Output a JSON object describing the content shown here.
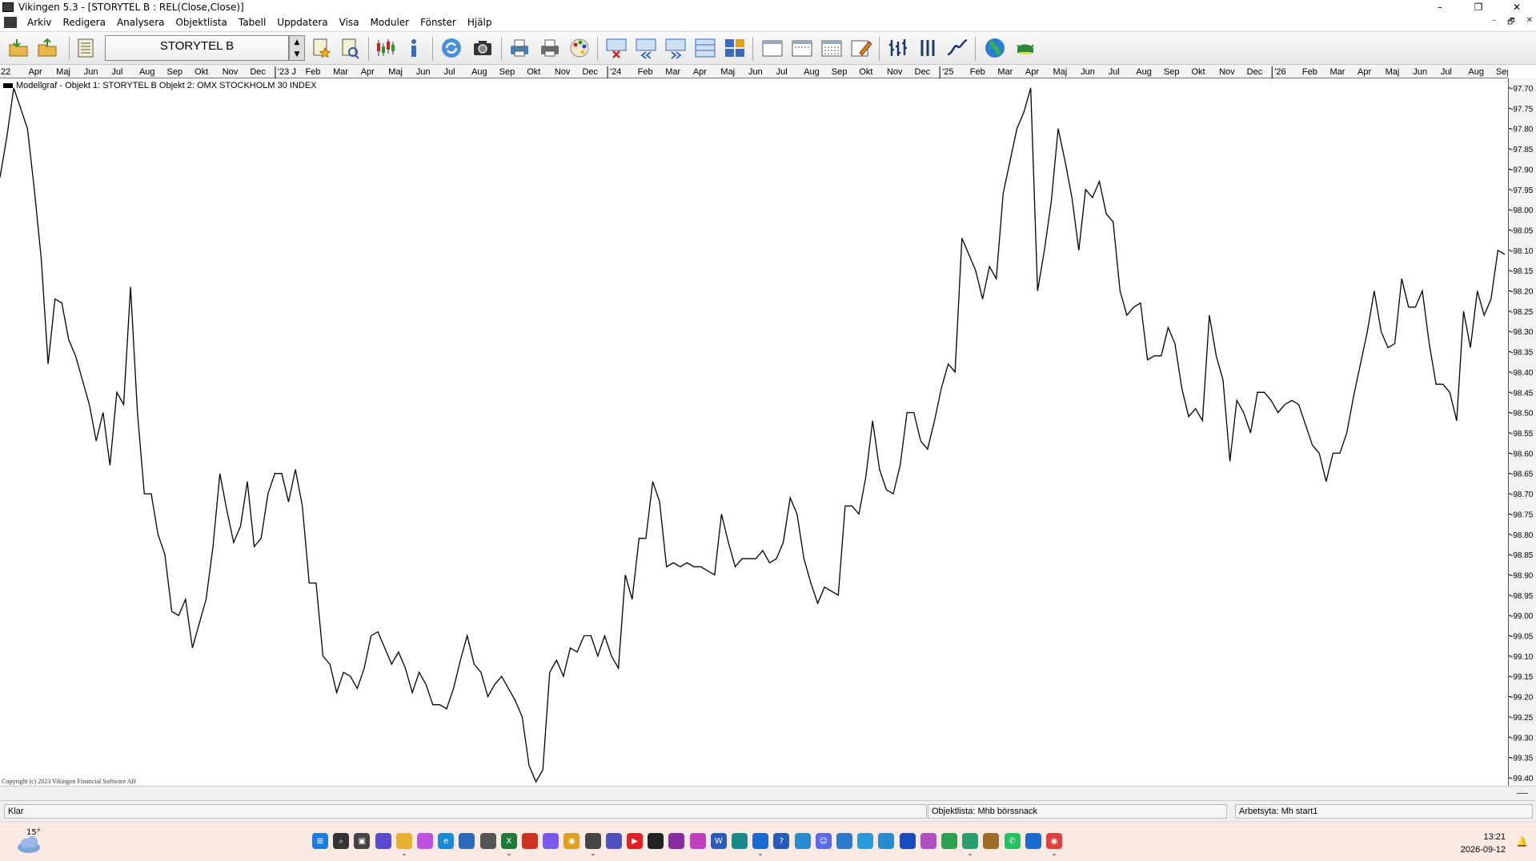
{
  "window": {
    "title": "Vikingen 5.3 - [STORYTEL B : REL(Close,Close)]",
    "minimize": "–",
    "restore": "❐",
    "close": "✕"
  },
  "menu": {
    "items": [
      "Arkiv",
      "Redigera",
      "Analysera",
      "Objektlista",
      "Tabell",
      "Uppdatera",
      "Visa",
      "Moduler",
      "Fönster",
      "Hjälp"
    ],
    "mdi_min": "–",
    "mdi_restore": "🗗",
    "mdi_close": "✕"
  },
  "toolbar": {
    "symbol": "STORYTEL B"
  },
  "chart": {
    "legend": "Modellgraf - Objekt 1: STORYTEL B  Objekt 2: OMX STOCKHOLM 30 INDEX",
    "copyright": "Copyright (c) 2023 Vikingen Financial Software AB",
    "line_color": "#000000"
  },
  "chart_data": {
    "type": "line",
    "x_labels": [
      "22",
      "Apr",
      "Maj",
      "Jun",
      "Jul",
      "Aug",
      "Sep",
      "Okt",
      "Nov",
      "Dec",
      "'23 J",
      "Feb",
      "Mar",
      "Apr",
      "Maj",
      "Jun",
      "Jul",
      "Aug",
      "Sep",
      "Okt",
      "Nov",
      "Dec",
      "'24",
      "Feb",
      "Mar",
      "Apr",
      "Maj",
      "Jun",
      "Jul",
      "Aug",
      "Sep",
      "Okt",
      "Nov",
      "Dec",
      "'25",
      "Feb",
      "Mar",
      "Apr",
      "Maj",
      "Jun",
      "Jul",
      "Aug",
      "Sep",
      "Okt",
      "Nov",
      "Dec",
      "'26",
      "Feb",
      "Mar",
      "Apr",
      "Maj",
      "Jun",
      "Jul",
      "Aug",
      "Sep"
    ],
    "y_ticks": [
      "-97.70",
      "-97.75",
      "-97.80",
      "-97.85",
      "-97.90",
      "-97.95",
      "-98.00",
      "-98.05",
      "-98.10",
      "-98.15",
      "-98.20",
      "-98.25",
      "-98.30",
      "-98.35",
      "-98.40",
      "-98.45",
      "-98.50",
      "-98.55",
      "-98.60",
      "-98.65",
      "-98.70",
      "-98.75",
      "-98.80",
      "-98.85",
      "-98.90",
      "-98.95",
      "-99.00",
      "-99.05",
      "-99.10",
      "-99.15",
      "-99.20",
      "-99.25",
      "-99.30",
      "-99.35",
      "-99.40"
    ],
    "ylim": [
      -99.4,
      -97.7
    ],
    "values": [
      -97.92,
      -97.82,
      -97.7,
      -97.75,
      -97.8,
      -97.95,
      -98.12,
      -98.38,
      -98.22,
      -98.23,
      -98.32,
      -98.36,
      -98.42,
      -98.48,
      -98.57,
      -98.5,
      -98.63,
      -98.45,
      -98.48,
      -98.19,
      -98.5,
      -98.7,
      -98.7,
      -98.8,
      -98.85,
      -98.99,
      -99.0,
      -98.96,
      -99.08,
      -99.02,
      -98.96,
      -98.83,
      -98.65,
      -98.74,
      -98.82,
      -98.78,
      -98.67,
      -98.83,
      -98.81,
      -98.7,
      -98.65,
      -98.65,
      -98.72,
      -98.64,
      -98.73,
      -98.92,
      -98.92,
      -99.1,
      -99.12,
      -99.19,
      -99.14,
      -99.15,
      -99.18,
      -99.13,
      -99.05,
      -99.04,
      -99.08,
      -99.12,
      -99.09,
      -99.13,
      -99.19,
      -99.14,
      -99.17,
      -99.22,
      -99.22,
      -99.23,
      -99.18,
      -99.11,
      -99.05,
      -99.12,
      -99.14,
      -99.2,
      -99.17,
      -99.15,
      -99.18,
      -99.21,
      -99.25,
      -99.37,
      -99.41,
      -99.38,
      -99.14,
      -99.11,
      -99.15,
      -99.08,
      -99.09,
      -99.05,
      -99.05,
      -99.1,
      -99.05,
      -99.1,
      -99.13,
      -98.9,
      -98.96,
      -98.81,
      -98.81,
      -98.67,
      -98.72,
      -98.88,
      -98.87,
      -98.88,
      -98.87,
      -98.88,
      -98.88,
      -98.89,
      -98.9,
      -98.75,
      -98.82,
      -98.88,
      -98.86,
      -98.86,
      -98.86,
      -98.84,
      -98.87,
      -98.86,
      -98.82,
      -98.71,
      -98.75,
      -98.86,
      -98.92,
      -98.97,
      -98.93,
      -98.94,
      -98.95,
      -98.73,
      -98.73,
      -98.75,
      -98.66,
      -98.52,
      -98.64,
      -98.69,
      -98.7,
      -98.63,
      -98.5,
      -98.5,
      -98.57,
      -98.59,
      -98.52,
      -98.44,
      -98.38,
      -98.4,
      -98.07,
      -98.11,
      -98.15,
      -98.22,
      -98.14,
      -98.17,
      -97.96,
      -97.88,
      -97.8,
      -97.76,
      -97.7,
      -98.2,
      -98.1,
      -97.98,
      -97.8,
      -97.88,
      -97.97,
      -98.1,
      -97.95,
      -97.97,
      -97.93,
      -98.01,
      -98.03,
      -98.2,
      -98.26,
      -98.24,
      -98.23,
      -98.37,
      -98.36,
      -98.36,
      -98.29,
      -98.33,
      -98.44,
      -98.51,
      -98.49,
      -98.52,
      -98.26,
      -98.36,
      -98.42,
      -98.62,
      -98.47,
      -98.5,
      -98.55,
      -98.45,
      -98.45,
      -98.47,
      -98.5,
      -98.48,
      -98.47,
      -98.48,
      -98.53,
      -98.58,
      -98.6,
      -98.67,
      -98.6,
      -98.6,
      -98.55,
      -98.46,
      -98.38,
      -98.3,
      -98.2,
      -98.3,
      -98.34,
      -98.33,
      -98.17,
      -98.24,
      -98.24,
      -98.2,
      -98.33,
      -98.43,
      -98.43,
      -98.45,
      -98.52,
      -98.25,
      -98.34,
      -98.2,
      -98.26,
      -98.22,
      -98.1,
      -98.11
    ]
  },
  "status": {
    "left": "Klar",
    "objektlista": "Objektlista: Mhb börssnack",
    "arbetsyta": "Arbetsyta: Mh start1"
  },
  "taskbar": {
    "temp": "15°",
    "time": "13:21",
    "date": "2026-09-12",
    "apps": [
      "windows-start",
      "search",
      "taskview",
      "snipping-tool",
      "file-explorer",
      "copilot",
      "edge",
      "store",
      "camera",
      "excel",
      "acrobat",
      "messenger",
      "chrome",
      "vikingen",
      "teams",
      "youtube",
      "notepad",
      "onenote",
      "paint",
      "word",
      "edge-dev",
      "outlook",
      "help",
      "remote-desktop",
      "discord",
      "app-blue1",
      "app-blue2",
      "app-blue3",
      "app-blue4",
      "app-purple",
      "app-green1",
      "app-green2",
      "app-fox",
      "whatsapp",
      "outlook2",
      "chrome2"
    ]
  }
}
